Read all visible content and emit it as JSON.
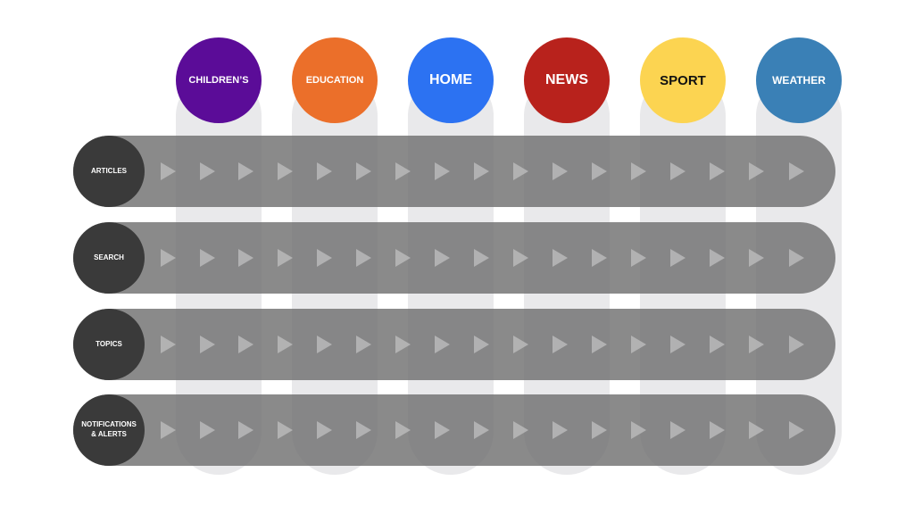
{
  "columns": [
    {
      "label": "CHILDREN’S",
      "color": "#5b0c98",
      "text_color": "#ffffff"
    },
    {
      "label": "EDUCATION",
      "color": "#eb6f2a",
      "text_color": "#ffffff"
    },
    {
      "label": "HOME",
      "color": "#2c72f2",
      "text_color": "#ffffff"
    },
    {
      "label": "NEWS",
      "color": "#b8221c",
      "text_color": "#ffffff"
    },
    {
      "label": "SPORT",
      "color": "#fcd451",
      "text_color": "#111111"
    },
    {
      "label": "WEATHER",
      "color": "#3a80b6",
      "text_color": "#ffffff"
    }
  ],
  "rows": [
    {
      "label": "ARTICLES"
    },
    {
      "label": "SEARCH"
    },
    {
      "label": "TOPICS"
    },
    {
      "label": "NOTIFICATIONS & ALERTS"
    }
  ],
  "arrow_icon": "play-arrow-icon"
}
